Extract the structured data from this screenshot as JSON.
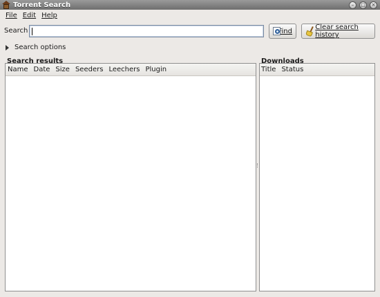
{
  "window": {
    "title": "Torrent Search"
  },
  "menubar": {
    "items": [
      {
        "label": "File"
      },
      {
        "label": "Edit"
      },
      {
        "label": "Help"
      }
    ]
  },
  "search": {
    "label": "Search",
    "value": "",
    "find_label": "Find",
    "clear_label": "Clear search history"
  },
  "search_options": {
    "label": "Search options"
  },
  "results": {
    "title": "Search results",
    "columns": [
      "Name",
      "Date",
      "Size",
      "Seeders",
      "Leechers",
      "Plugin"
    ]
  },
  "downloads": {
    "title": "Downloads",
    "columns": [
      "Title",
      "Status"
    ]
  },
  "icons": {
    "app": "app-house-icon",
    "find": "find-icon",
    "clear": "broom-icon",
    "expander": "expander-right-icon"
  }
}
